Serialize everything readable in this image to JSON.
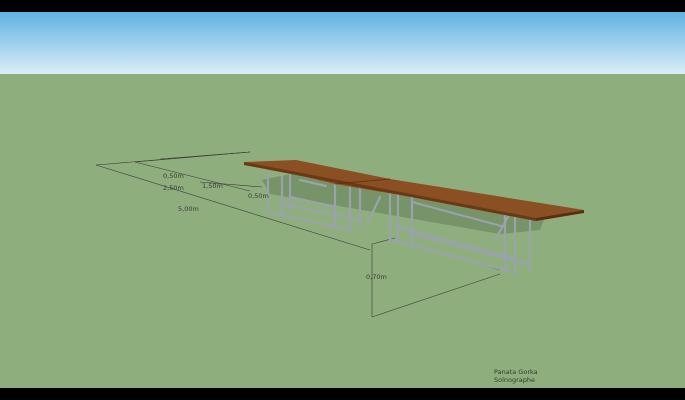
{
  "scene": {
    "colors": {
      "letterbox": "#000000",
      "sky_top": "#5fb2e4",
      "sky_bottom": "#dcedf6",
      "ground": "#8fae7d",
      "wood_top": "#8a4f22",
      "wood_edge": "#6b3715",
      "frame_metal": "#9aa3ab",
      "shadow": "#6f8a61",
      "dimension_line": "#3a3a3a"
    },
    "dimensions": {
      "d1": "0,50m",
      "d2": "1,50m",
      "d3": "2,50m",
      "d4": "0,50m",
      "d5": "5,00m",
      "d6": "0,70m"
    },
    "credit": {
      "line1": "Panata Gorka",
      "line2": "Solnographe"
    }
  }
}
